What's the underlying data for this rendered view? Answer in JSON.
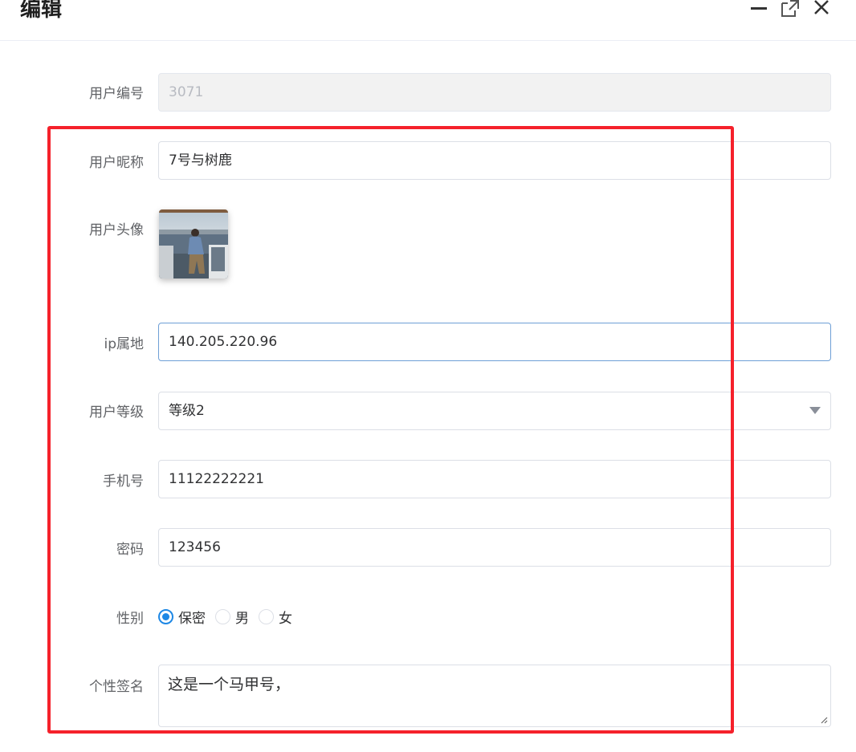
{
  "dialog": {
    "title": "编辑",
    "minimize_icon": "minimize-icon",
    "maximize_icon": "maximize-icon",
    "close_icon": "close-icon"
  },
  "form": {
    "user_id": {
      "label": "用户编号",
      "value": "3071"
    },
    "nickname": {
      "label": "用户昵称",
      "value": "7号与树鹿"
    },
    "avatar": {
      "label": "用户头像"
    },
    "ip": {
      "label": "ip属地",
      "value": "140.205.220.96"
    },
    "level": {
      "label": "用户等级",
      "value": "等级2"
    },
    "phone": {
      "label": "手机号",
      "value": "11122222221"
    },
    "password": {
      "label": "密码",
      "value": "123456"
    },
    "gender": {
      "label": "性别",
      "options": [
        "保密",
        "男",
        "女"
      ],
      "selected": "保密"
    },
    "signature": {
      "label": "个性签名",
      "value": "这是一个马甲号，"
    }
  },
  "colors": {
    "accent": "#1e88e5",
    "highlight": "#f5212b",
    "focus_border": "#6e9fd6"
  }
}
